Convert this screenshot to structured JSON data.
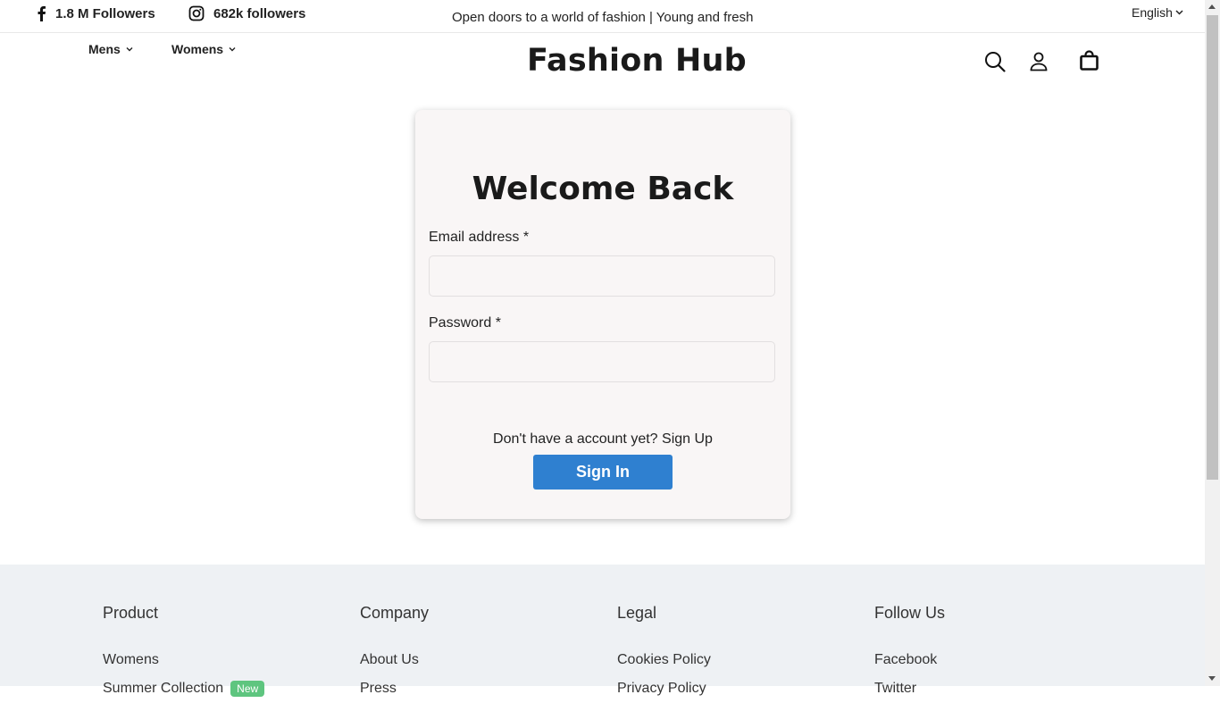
{
  "topbar": {
    "facebook_followers": "1.8 M Followers",
    "instagram_followers": "682k followers",
    "tagline": "Open doors to a world of fashion | Young and fresh",
    "language": "English"
  },
  "nav": {
    "items": [
      {
        "label": "Mens"
      },
      {
        "label": "Womens"
      }
    ],
    "brand": "Fashion Hub",
    "icons": [
      "search-icon",
      "user-icon",
      "bag-icon"
    ]
  },
  "login": {
    "title": "Welcome Back",
    "email_label": "Email address *",
    "email_value": "",
    "password_label": "Password *",
    "password_value": "",
    "signup_prompt": "Don't have a account yet?",
    "signup_link": "Sign Up",
    "signin_button": "Sign In"
  },
  "footer": {
    "columns": [
      {
        "heading": "Product",
        "links": [
          "Womens",
          "Summer Collection"
        ],
        "badge": "New"
      },
      {
        "heading": "Company",
        "links": [
          "About Us",
          "Press"
        ]
      },
      {
        "heading": "Legal",
        "links": [
          "Cookies Policy",
          "Privacy Policy"
        ]
      },
      {
        "heading": "Follow Us",
        "links": [
          "Facebook",
          "Twitter"
        ]
      }
    ]
  },
  "colors": {
    "primary_button": "#2f80d0",
    "badge": "#5ec57f",
    "card_bg": "#f9f6f6",
    "footer_bg": "#eef1f4"
  }
}
